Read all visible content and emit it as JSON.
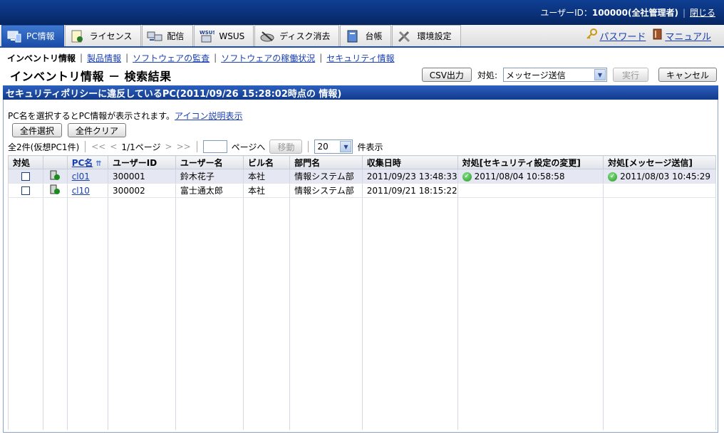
{
  "header": {
    "user_label": "ユーザーID：",
    "user_id": "100000(全社管理者)",
    "close_link": "閉じる"
  },
  "tabs": [
    {
      "label": "PC情報",
      "icon": "pc-info-icon",
      "active": true
    },
    {
      "label": "ライセンス",
      "icon": "license-icon",
      "active": false
    },
    {
      "label": "配信",
      "icon": "distribution-icon",
      "active": false
    },
    {
      "label": "WSUS",
      "icon": "wsus-icon",
      "active": false
    },
    {
      "label": "ディスク消去",
      "icon": "disk-erase-icon",
      "active": false
    },
    {
      "label": "台帳",
      "icon": "ledger-icon",
      "active": false
    },
    {
      "label": "環境設定",
      "icon": "settings-tools-icon",
      "active": false
    }
  ],
  "right_links": {
    "password": "パスワード",
    "manual": "マニュアル"
  },
  "subnav": {
    "current": "インベントリ情報",
    "links": [
      "製品情報",
      "ソフトウェアの監査",
      "ソフトウェアの稼働状況",
      "セキュリティ情報"
    ]
  },
  "title": "インベントリ情報 － 検索結果",
  "toolbar": {
    "csv_button": "CSV出力",
    "action_label": "対処:",
    "action_value": "メッセージ送信",
    "run_button": "実行",
    "cancel_button": "キャンセル"
  },
  "section_title": "セキュリティポリシーに違反しているPC(2011/09/26 15:28:02時点の 情報)",
  "info": {
    "text": "PC名を選択するとPC情報が表示されます。",
    "icon_link": "アイコン説明表示"
  },
  "bulk": {
    "select_all": "全件選択",
    "clear_all": "全件クリア"
  },
  "pager": {
    "count": "全2件(仮想PC1件)",
    "first": "<<",
    "prev": "<",
    "page": "1/1ページ",
    "next": ">",
    "last": ">>",
    "goto_label": "ページへ",
    "goto_button": "移動",
    "per_page": "20",
    "per_page_label": "件表示"
  },
  "table": {
    "headers": [
      "対処",
      "",
      "PC名",
      "ユーザーID",
      "ユーザー名",
      "ビル名",
      "部門名",
      "収集日時",
      "対処[セキュリティ設定の変更]",
      "対処[メッセージ送信]"
    ],
    "rows": [
      {
        "pc": "cl01",
        "user_id": "300001",
        "user_name": "鈴木花子",
        "building": "本社",
        "dept": "情報システム部",
        "collected": "2011/09/23 13:48:33",
        "sec_change": "2011/08/04 10:58:58",
        "msg_sent": "2011/08/03 10:45:29"
      },
      {
        "pc": "cl10",
        "user_id": "300002",
        "user_name": "富士通太郎",
        "building": "本社",
        "dept": "情報システム部",
        "collected": "2011/09/21 18:15:22",
        "sec_change": "",
        "msg_sent": ""
      }
    ]
  },
  "colors": {
    "header_blue": "#0a3078",
    "tab_active": "#1a4ea8",
    "row_alt": "#e5e8f2",
    "ok_green": "#1b9b1b"
  }
}
